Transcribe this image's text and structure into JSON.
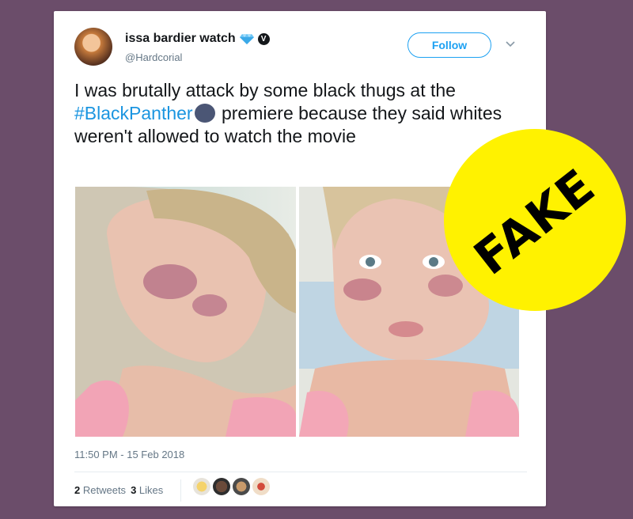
{
  "tweet": {
    "author_name": "issa bardier watch",
    "handle": "@Hardcorial",
    "follow_label": "Follow",
    "text_before_hashtag": "I was brutally attack by some black thugs at the ",
    "hashtag": "#BlackPanther",
    "text_after_hashtag": " premiere because they said whites weren't allowed to watch the movie",
    "timestamp": "11:50 PM - 15 Feb 2018",
    "retweets_count": "2",
    "retweets_label": "Retweets",
    "likes_count": "3",
    "likes_label": "Likes"
  },
  "overlay": {
    "stamp_text": "FAKE",
    "stamp_color": "#fff200"
  },
  "colors": {
    "background": "#6b4d6a",
    "link": "#1b95e0",
    "follow": "#1da1f2"
  },
  "icons": [
    "diamond-icon",
    "verified-icon",
    "chevron-down-icon",
    "black-panther-emoji-icon"
  ]
}
